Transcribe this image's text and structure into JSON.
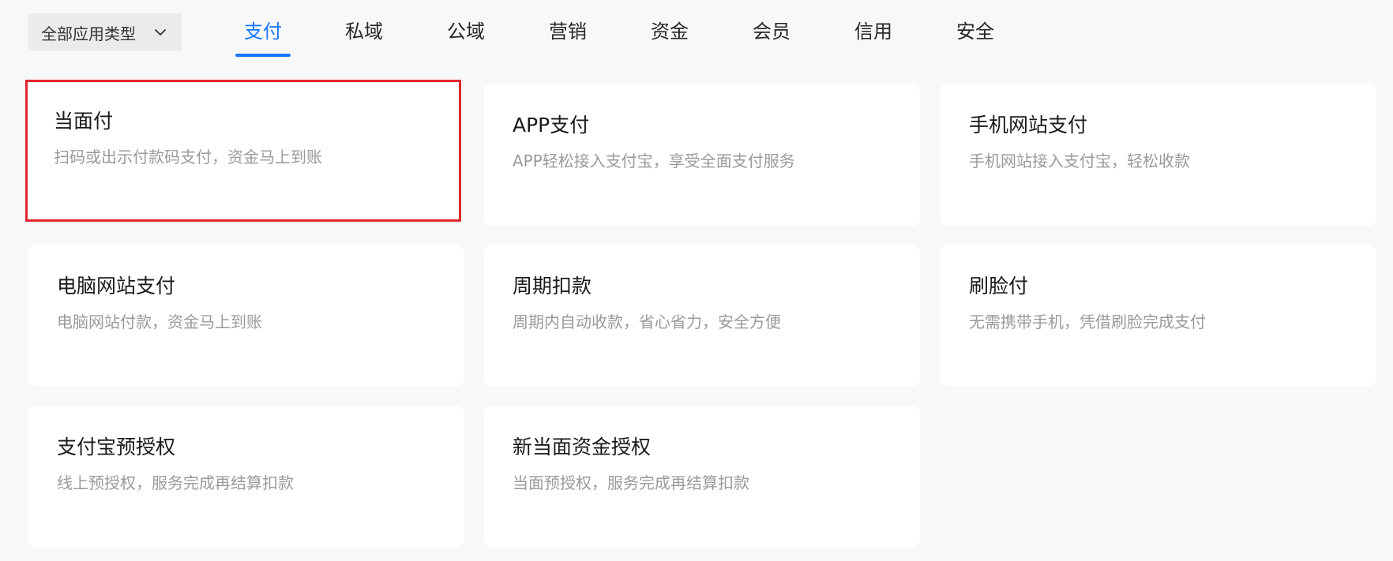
{
  "filter": {
    "label": "全部应用类型",
    "icon": "chevron-down-icon"
  },
  "tabs": [
    {
      "label": "支付",
      "active": true
    },
    {
      "label": "私域",
      "active": false
    },
    {
      "label": "公域",
      "active": false
    },
    {
      "label": "营销",
      "active": false
    },
    {
      "label": "资金",
      "active": false
    },
    {
      "label": "会员",
      "active": false
    },
    {
      "label": "信用",
      "active": false
    },
    {
      "label": "安全",
      "active": false
    }
  ],
  "cards": [
    {
      "title": "当面付",
      "desc": "扫码或出示付款码支付，资金马上到账",
      "selected": true
    },
    {
      "title": "APP支付",
      "desc": "APP轻松接入支付宝，享受全面支付服务",
      "selected": false
    },
    {
      "title": "手机网站支付",
      "desc": "手机网站接入支付宝，轻松收款",
      "selected": false
    },
    {
      "title": "电脑网站支付",
      "desc": "电脑网站付款，资金马上到账",
      "selected": false
    },
    {
      "title": "周期扣款",
      "desc": "周期内自动收款，省心省力，安全方便",
      "selected": false
    },
    {
      "title": "刷脸付",
      "desc": "无需携带手机，凭借刷脸完成支付",
      "selected": false
    },
    {
      "title": "支付宝预授权",
      "desc": "线上预授权，服务完成再结算扣款",
      "selected": false
    },
    {
      "title": "新当面资金授权",
      "desc": "当面预授权，服务完成再结算扣款",
      "selected": false
    }
  ],
  "colors": {
    "accent": "#1677ff",
    "selected_border": "#e0282e",
    "background": "#f7f8fa"
  }
}
